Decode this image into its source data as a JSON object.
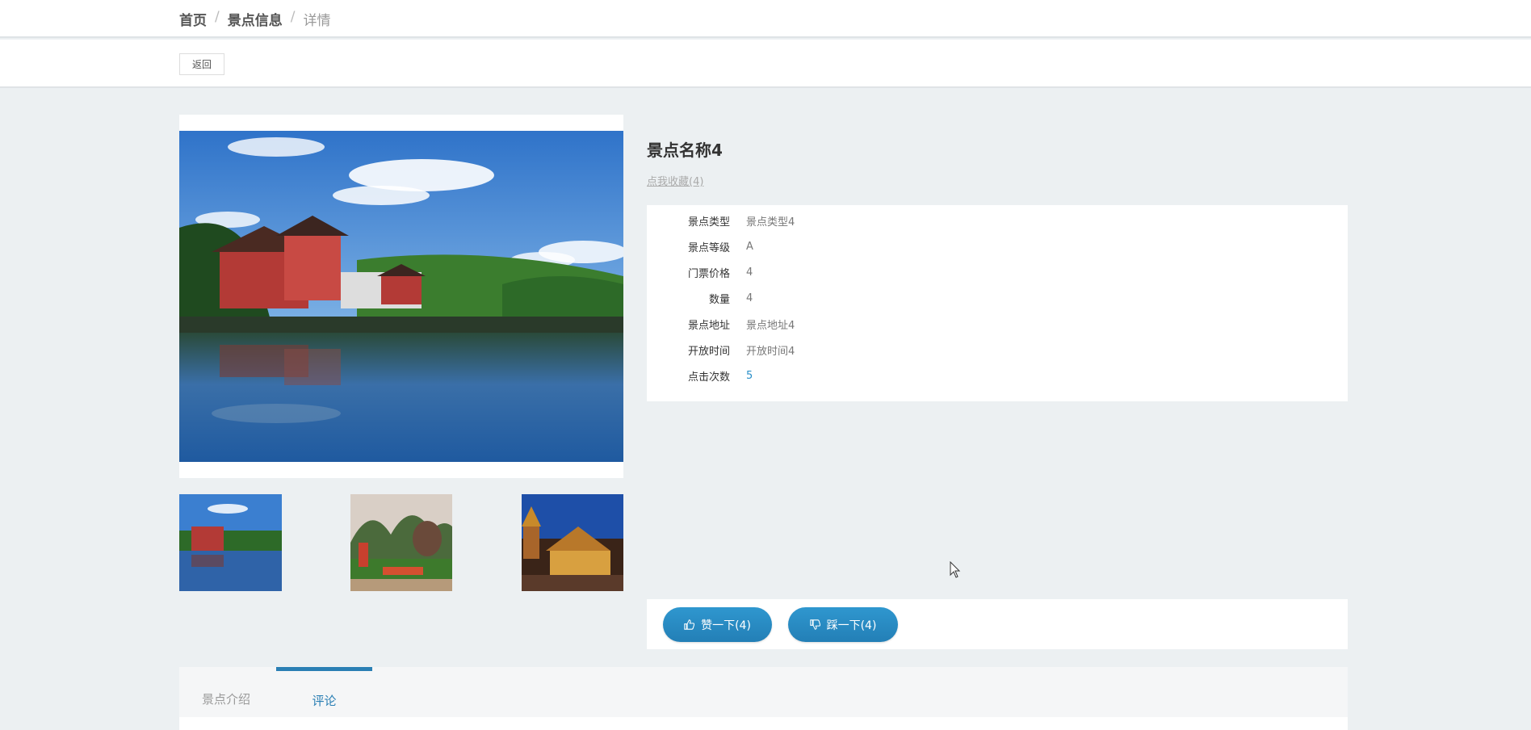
{
  "breadcrumb": {
    "home": "首页",
    "section": "景点信息",
    "current": "详情"
  },
  "toolbar": {
    "back_label": "返回"
  },
  "detail": {
    "title": "景点名称4",
    "favorite_label": "点我收藏(4)",
    "info": [
      {
        "label": "景点类型",
        "value": "景点类型4"
      },
      {
        "label": "景点等级",
        "value": "A"
      },
      {
        "label": "门票价格",
        "value": "4"
      },
      {
        "label": "数量",
        "value": "4"
      },
      {
        "label": "景点地址",
        "value": "景点地址4"
      },
      {
        "label": "开放时间",
        "value": "开放时间4"
      },
      {
        "label": "点击次数",
        "value": "5"
      }
    ]
  },
  "vote": {
    "like_label": "赞一下(4)",
    "dislike_label": "踩一下(4)"
  },
  "tabs": [
    {
      "label": "景点介绍"
    },
    {
      "label": "评论"
    }
  ],
  "colors": {
    "accent": "#2a7fb4",
    "link_blue": "#2a8fc9",
    "background": "#ecf0f2"
  },
  "icons": {
    "like": "thumbs-up-icon",
    "dislike": "thumbs-down-icon",
    "cursor": "mouse-pointer-icon"
  }
}
